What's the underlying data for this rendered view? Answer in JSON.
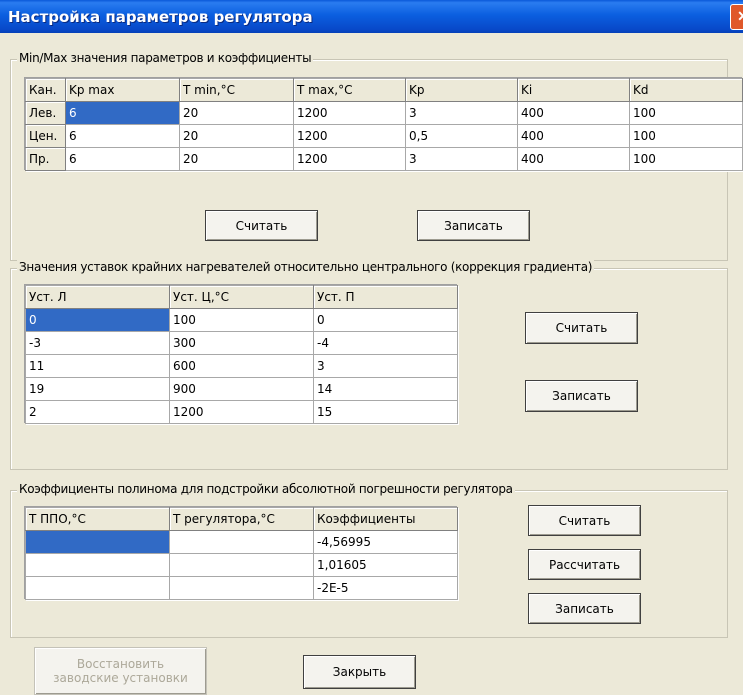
{
  "window": {
    "title": "Настройка параметров регулятора",
    "close_glyph": "✕"
  },
  "group1": {
    "caption": "Min/Max значения параметров и коэффициенты",
    "columns": [
      "Кан.",
      "Kp max",
      "T min,°C",
      "T max,°C",
      "Kp",
      "Ki",
      "Kd"
    ],
    "rows": [
      [
        "Лев.",
        "6",
        "20",
        "1200",
        "3",
        "400",
        "100"
      ],
      [
        "Цен.",
        "6",
        "20",
        "1200",
        "0,5",
        "400",
        "100"
      ],
      [
        "Пр.",
        "6",
        "20",
        "1200",
        "3",
        "400",
        "100"
      ]
    ],
    "read_button": "Считать",
    "write_button": "Записать"
  },
  "group2": {
    "caption": "Значения уставок крайних нагревателей относительно центрального (коррекция градиента)",
    "columns": [
      "Уст. Л",
      "Уст. Ц,°С",
      "Уст. П"
    ],
    "rows": [
      [
        "0",
        "100",
        "0"
      ],
      [
        "-3",
        "300",
        "-4"
      ],
      [
        "11",
        "600",
        "3"
      ],
      [
        "19",
        "900",
        "14"
      ],
      [
        "2",
        "1200",
        "15"
      ]
    ],
    "read_button": "Считать",
    "write_button": "Записать"
  },
  "group3": {
    "caption": "Коэффициенты полинома для подстройки абсолютной погрешности регулятора",
    "columns": [
      "Т ППО,°С",
      "Т регулятора,°С",
      "Коэффициенты"
    ],
    "rows": [
      [
        "",
        "",
        "-4,56995"
      ],
      [
        "",
        "",
        "1,01605"
      ],
      [
        "",
        "",
        "-2E-5"
      ]
    ],
    "read_button": "Считать",
    "calc_button": "Рассчитать",
    "write_button": "Записать"
  },
  "footer": {
    "restore_line1": "Восстановить",
    "restore_line2": "заводские установки",
    "close_button": "Закрыть"
  }
}
